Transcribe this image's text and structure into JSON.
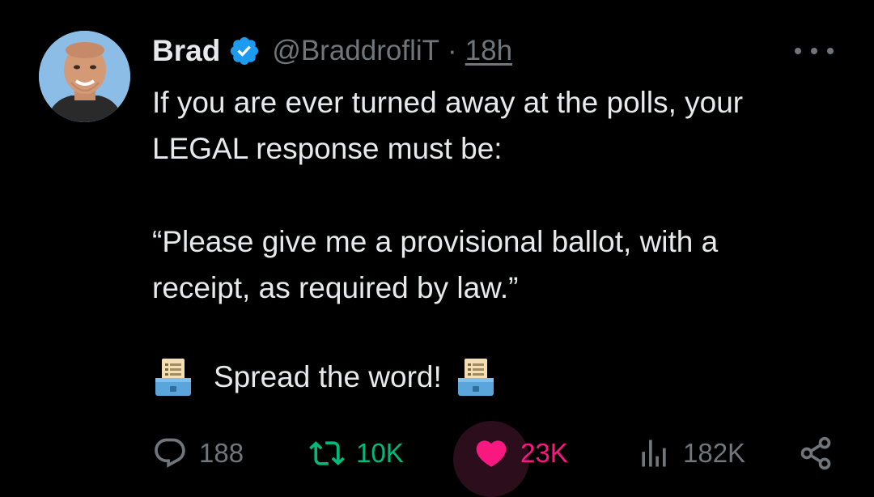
{
  "author": {
    "name": "Brad",
    "handle": "@BraddrofliT",
    "separator": "·",
    "time": "18h"
  },
  "tweet": {
    "lines": [
      "If you are ever turned away at the polls, your",
      "LEGAL response must be:",
      "“Please give me a provisional ballot, with a",
      "receipt, as required by law.”"
    ],
    "spread_text": "Spread the word!"
  },
  "stats": {
    "replies": "188",
    "retweets": "10K",
    "likes": "23K",
    "views": "182K"
  },
  "icons": {
    "verified": "verified-badge-icon",
    "more": "more-icon",
    "reply": "reply-icon",
    "retweet": "retweet-icon",
    "like": "heart-icon",
    "views": "views-icon",
    "share": "share-icon",
    "emoji": "ballot-box-emoji"
  },
  "colors": {
    "background": "#000000",
    "text": "#e7e9ea",
    "muted": "#71767b",
    "verified": "#1d9bf0",
    "retweet": "#00ba7c",
    "like": "#f91880"
  }
}
